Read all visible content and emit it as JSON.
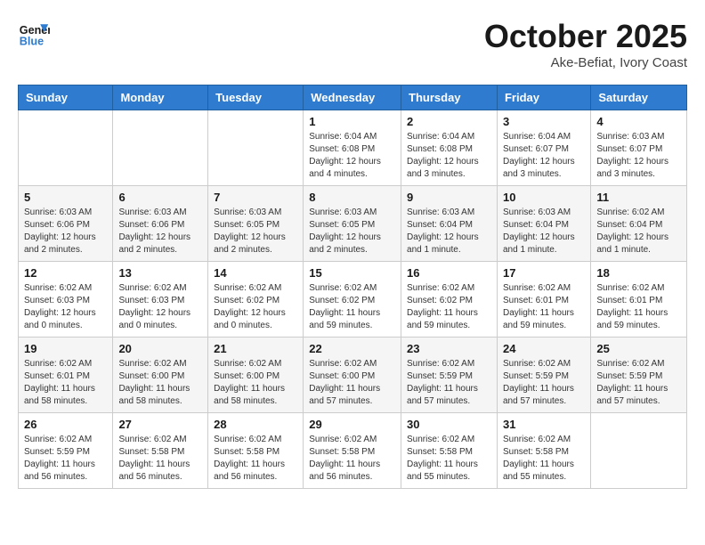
{
  "header": {
    "logo_line1": "General",
    "logo_line2": "Blue",
    "title": "October 2025",
    "subtitle": "Ake-Befiat, Ivory Coast"
  },
  "weekdays": [
    "Sunday",
    "Monday",
    "Tuesday",
    "Wednesday",
    "Thursday",
    "Friday",
    "Saturday"
  ],
  "weeks": [
    [
      {
        "day": "",
        "info": ""
      },
      {
        "day": "",
        "info": ""
      },
      {
        "day": "",
        "info": ""
      },
      {
        "day": "1",
        "info": "Sunrise: 6:04 AM\nSunset: 6:08 PM\nDaylight: 12 hours\nand 4 minutes."
      },
      {
        "day": "2",
        "info": "Sunrise: 6:04 AM\nSunset: 6:08 PM\nDaylight: 12 hours\nand 3 minutes."
      },
      {
        "day": "3",
        "info": "Sunrise: 6:04 AM\nSunset: 6:07 PM\nDaylight: 12 hours\nand 3 minutes."
      },
      {
        "day": "4",
        "info": "Sunrise: 6:03 AM\nSunset: 6:07 PM\nDaylight: 12 hours\nand 3 minutes."
      }
    ],
    [
      {
        "day": "5",
        "info": "Sunrise: 6:03 AM\nSunset: 6:06 PM\nDaylight: 12 hours\nand 2 minutes."
      },
      {
        "day": "6",
        "info": "Sunrise: 6:03 AM\nSunset: 6:06 PM\nDaylight: 12 hours\nand 2 minutes."
      },
      {
        "day": "7",
        "info": "Sunrise: 6:03 AM\nSunset: 6:05 PM\nDaylight: 12 hours\nand 2 minutes."
      },
      {
        "day": "8",
        "info": "Sunrise: 6:03 AM\nSunset: 6:05 PM\nDaylight: 12 hours\nand 2 minutes."
      },
      {
        "day": "9",
        "info": "Sunrise: 6:03 AM\nSunset: 6:04 PM\nDaylight: 12 hours\nand 1 minute."
      },
      {
        "day": "10",
        "info": "Sunrise: 6:03 AM\nSunset: 6:04 PM\nDaylight: 12 hours\nand 1 minute."
      },
      {
        "day": "11",
        "info": "Sunrise: 6:02 AM\nSunset: 6:04 PM\nDaylight: 12 hours\nand 1 minute."
      }
    ],
    [
      {
        "day": "12",
        "info": "Sunrise: 6:02 AM\nSunset: 6:03 PM\nDaylight: 12 hours\nand 0 minutes."
      },
      {
        "day": "13",
        "info": "Sunrise: 6:02 AM\nSunset: 6:03 PM\nDaylight: 12 hours\nand 0 minutes."
      },
      {
        "day": "14",
        "info": "Sunrise: 6:02 AM\nSunset: 6:02 PM\nDaylight: 12 hours\nand 0 minutes."
      },
      {
        "day": "15",
        "info": "Sunrise: 6:02 AM\nSunset: 6:02 PM\nDaylight: 11 hours\nand 59 minutes."
      },
      {
        "day": "16",
        "info": "Sunrise: 6:02 AM\nSunset: 6:02 PM\nDaylight: 11 hours\nand 59 minutes."
      },
      {
        "day": "17",
        "info": "Sunrise: 6:02 AM\nSunset: 6:01 PM\nDaylight: 11 hours\nand 59 minutes."
      },
      {
        "day": "18",
        "info": "Sunrise: 6:02 AM\nSunset: 6:01 PM\nDaylight: 11 hours\nand 59 minutes."
      }
    ],
    [
      {
        "day": "19",
        "info": "Sunrise: 6:02 AM\nSunset: 6:01 PM\nDaylight: 11 hours\nand 58 minutes."
      },
      {
        "day": "20",
        "info": "Sunrise: 6:02 AM\nSunset: 6:00 PM\nDaylight: 11 hours\nand 58 minutes."
      },
      {
        "day": "21",
        "info": "Sunrise: 6:02 AM\nSunset: 6:00 PM\nDaylight: 11 hours\nand 58 minutes."
      },
      {
        "day": "22",
        "info": "Sunrise: 6:02 AM\nSunset: 6:00 PM\nDaylight: 11 hours\nand 57 minutes."
      },
      {
        "day": "23",
        "info": "Sunrise: 6:02 AM\nSunset: 5:59 PM\nDaylight: 11 hours\nand 57 minutes."
      },
      {
        "day": "24",
        "info": "Sunrise: 6:02 AM\nSunset: 5:59 PM\nDaylight: 11 hours\nand 57 minutes."
      },
      {
        "day": "25",
        "info": "Sunrise: 6:02 AM\nSunset: 5:59 PM\nDaylight: 11 hours\nand 57 minutes."
      }
    ],
    [
      {
        "day": "26",
        "info": "Sunrise: 6:02 AM\nSunset: 5:59 PM\nDaylight: 11 hours\nand 56 minutes."
      },
      {
        "day": "27",
        "info": "Sunrise: 6:02 AM\nSunset: 5:58 PM\nDaylight: 11 hours\nand 56 minutes."
      },
      {
        "day": "28",
        "info": "Sunrise: 6:02 AM\nSunset: 5:58 PM\nDaylight: 11 hours\nand 56 minutes."
      },
      {
        "day": "29",
        "info": "Sunrise: 6:02 AM\nSunset: 5:58 PM\nDaylight: 11 hours\nand 56 minutes."
      },
      {
        "day": "30",
        "info": "Sunrise: 6:02 AM\nSunset: 5:58 PM\nDaylight: 11 hours\nand 55 minutes."
      },
      {
        "day": "31",
        "info": "Sunrise: 6:02 AM\nSunset: 5:58 PM\nDaylight: 11 hours\nand 55 minutes."
      },
      {
        "day": "",
        "info": ""
      }
    ]
  ]
}
